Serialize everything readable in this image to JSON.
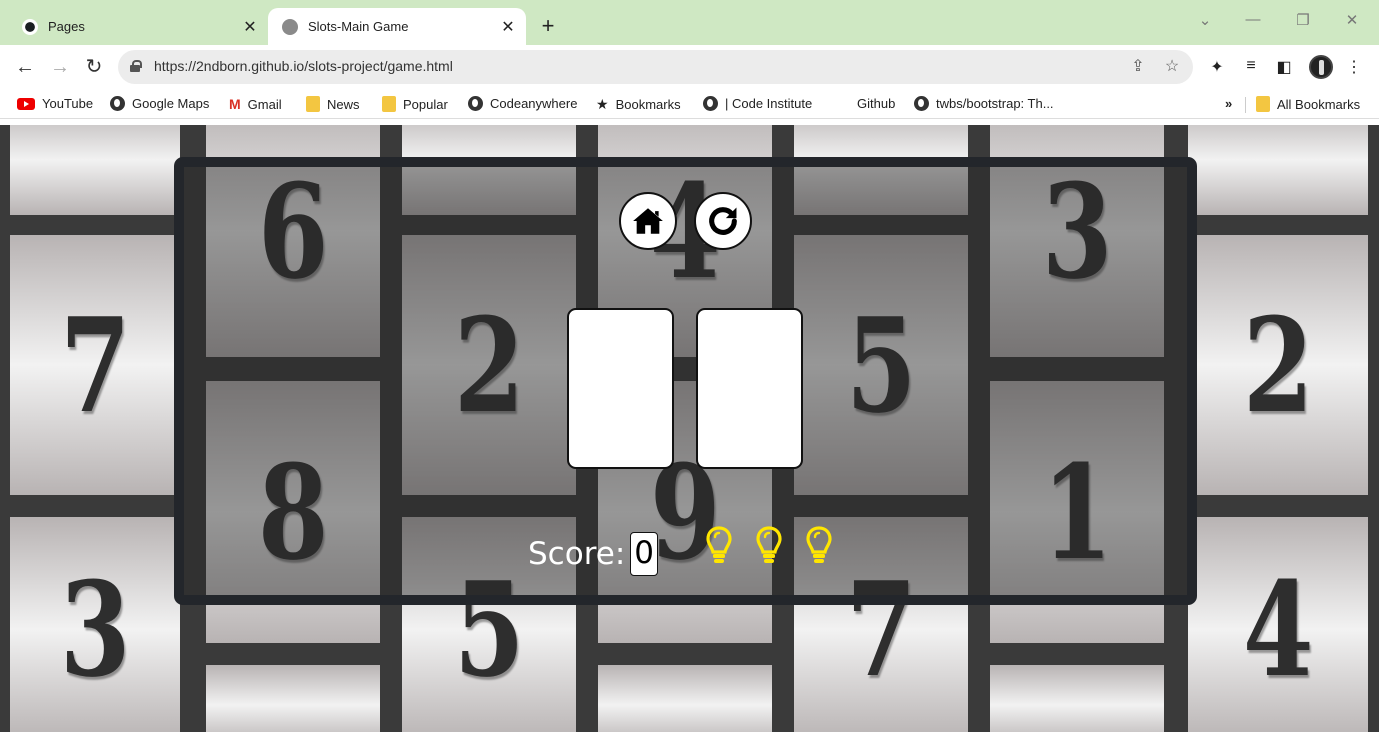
{
  "browser": {
    "tabs": [
      {
        "title": "Pages",
        "active": false,
        "icon": "github-icon"
      },
      {
        "title": "Slots-Main Game",
        "active": true,
        "icon": "globe-icon"
      }
    ],
    "new_tab_label": "+",
    "url": "https://2ndborn.github.io/slots-project/game.html",
    "bookmarks": [
      {
        "label": "YouTube",
        "icon": "youtube-icon"
      },
      {
        "label": "Google Maps",
        "icon": "globe-icon"
      },
      {
        "label": "Gmail",
        "icon": "gmail-icon"
      },
      {
        "label": "News",
        "icon": "folder-icon"
      },
      {
        "label": "Popular",
        "icon": "folder-icon"
      },
      {
        "label": "Codeanywhere",
        "icon": "globe-icon"
      },
      {
        "label": "Bookmarks",
        "icon": "star-icon"
      },
      {
        "label": "| Code Institute",
        "icon": "globe-icon"
      },
      {
        "label": "Github",
        "icon": "none"
      },
      {
        "label": "twbs/bootstrap: Th...",
        "icon": "globe-icon"
      }
    ],
    "bookmarks_overflow": "»",
    "all_bookmarks_label": "All Bookmarks"
  },
  "background_grid": {
    "column_1": [
      "7",
      "3"
    ],
    "column_2": [
      "6",
      "8"
    ],
    "column_3": [
      "2",
      "5"
    ],
    "column_4": [
      "4",
      "9"
    ],
    "column_5": [
      "5",
      "7"
    ],
    "column_6": [
      "3",
      "1"
    ],
    "column_7": [
      "2",
      "4"
    ]
  },
  "game": {
    "home_button_icon": "home-icon",
    "restart_button_icon": "restart-icon",
    "slots": [
      "",
      ""
    ],
    "score_label": "Score:",
    "score_value": "0",
    "hints_remaining": 3,
    "hint_color": "#ffe600"
  },
  "colors": {
    "tab_bar": "#cfe8c3",
    "modal_border": "#23262b",
    "page_dark": "#3a3a3a"
  }
}
